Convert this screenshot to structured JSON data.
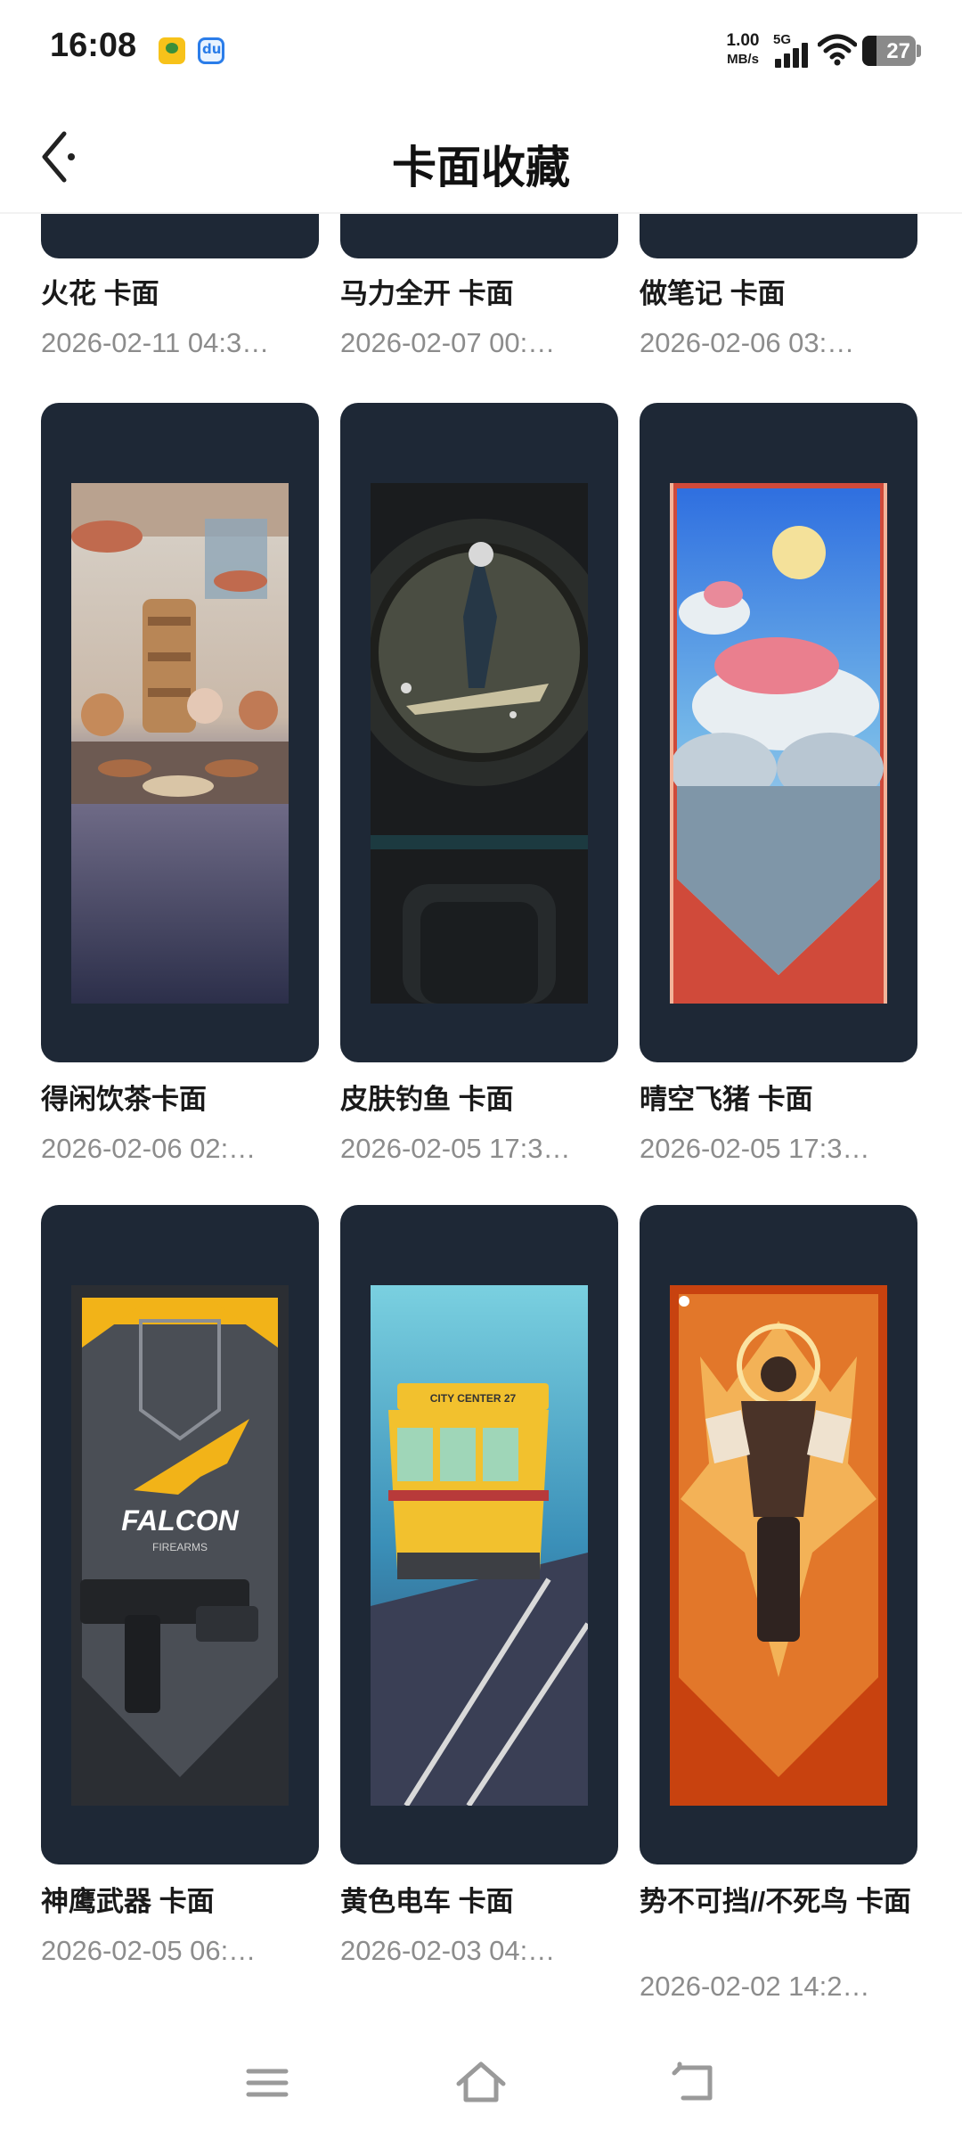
{
  "status_bar": {
    "time": "16:08",
    "net_speed_value": "1.00",
    "net_speed_unit": "MB/s",
    "network": "5G",
    "battery": "27",
    "battery_level_percent": 27
  },
  "header": {
    "title": "卡面收藏",
    "back_icon": "chevron-left-icon"
  },
  "cards": [
    {
      "name": "火花 卡面",
      "date": "2026-02-11 04:3…"
    },
    {
      "name": "马力全开 卡面",
      "date": "2026-02-07 00:…"
    },
    {
      "name": "做笔记 卡面",
      "date": "2026-02-06 03:…"
    },
    {
      "name": "得闲饮茶卡面",
      "date": "2026-02-06 02:…"
    },
    {
      "name": "皮肤钓鱼 卡面",
      "date": "2026-02-05 17:3…"
    },
    {
      "name": "晴空飞猪 卡面",
      "date": "2026-02-05 17:3…"
    },
    {
      "name": "神鹰武器 卡面",
      "date": "2026-02-05 06:…"
    },
    {
      "name": "黄色电车 卡面",
      "date": "2026-02-03 04:…"
    },
    {
      "name": "势不可挡//不死鸟 卡面",
      "date": "2026-02-02 14:2…"
    }
  ],
  "art_text": {
    "falcon_logo": "FALCON",
    "falcon_sub": "FIREARMS",
    "tram_sign": "CITY CENTER 27"
  },
  "colors": {
    "card_bg": "#1e2836",
    "text_primary": "#1a1a1a",
    "text_secondary": "#8c8c8c"
  },
  "nav": {
    "menu_icon": "menu-icon",
    "home_icon": "home-icon",
    "back_icon": "back-icon"
  }
}
